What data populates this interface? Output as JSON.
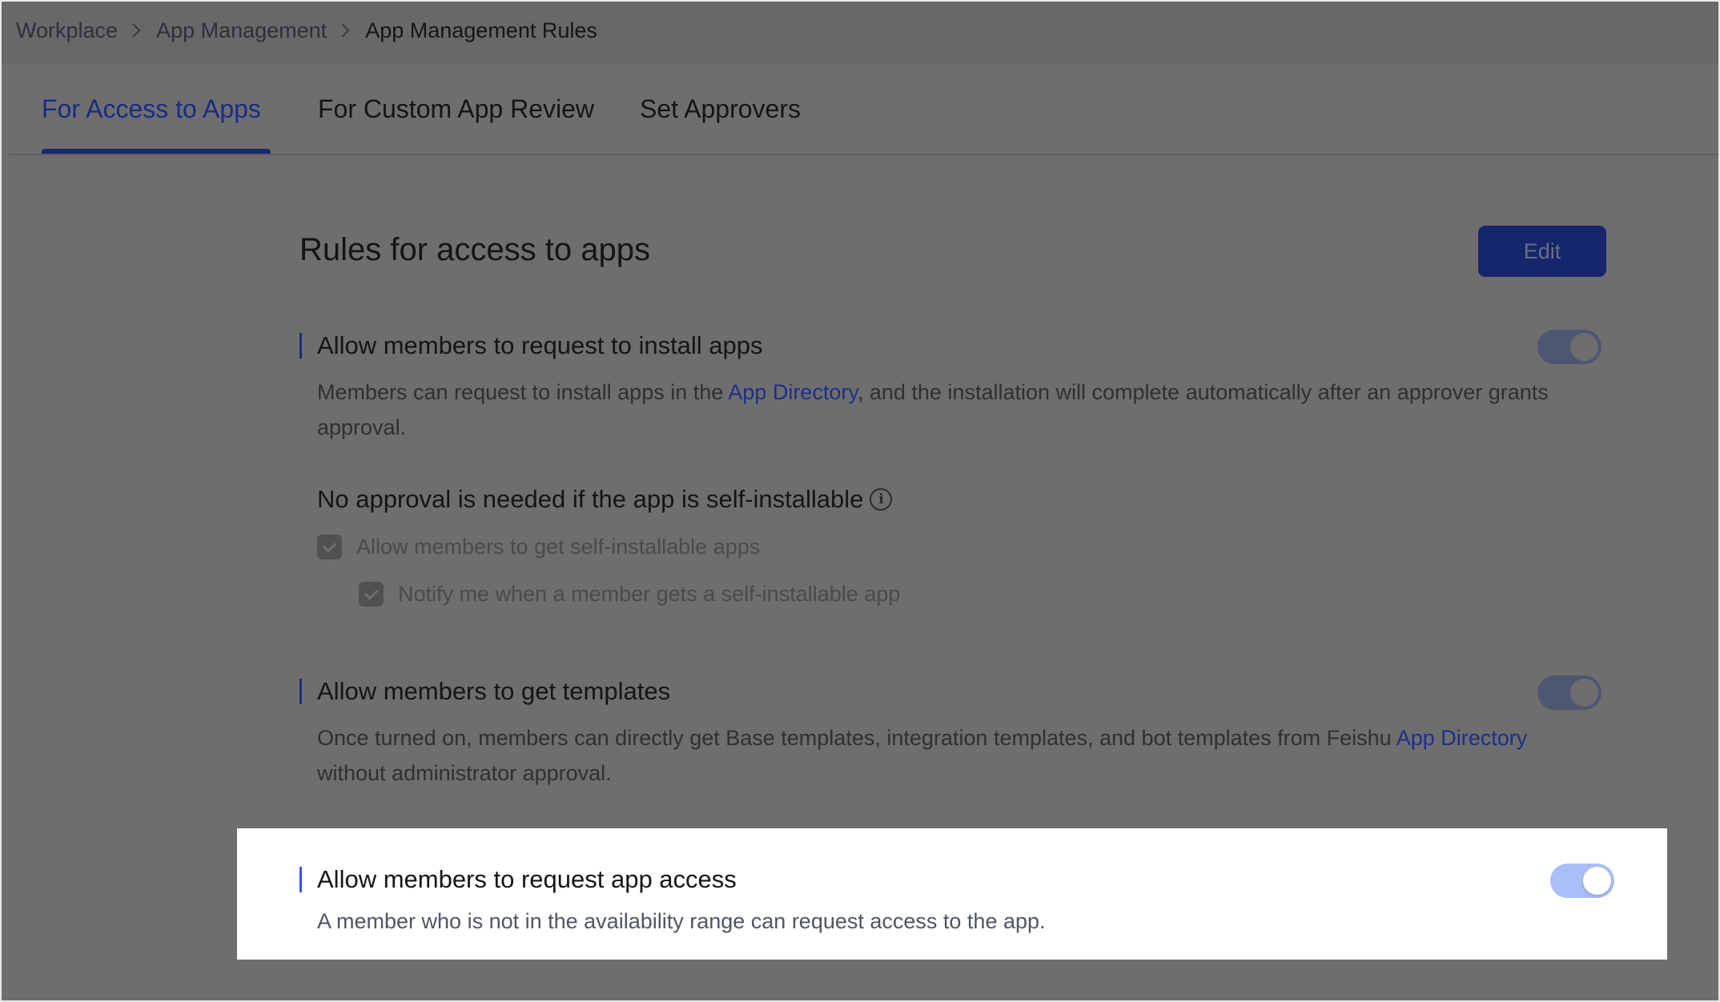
{
  "breadcrumb": {
    "items": [
      "Workplace",
      "App Management",
      "App Management Rules"
    ]
  },
  "tabs": [
    {
      "label": "For Access to Apps",
      "active": true
    },
    {
      "label": "For Custom App Review",
      "active": false
    },
    {
      "label": "Set Approvers",
      "active": false
    }
  ],
  "page": {
    "title": "Rules for access to apps",
    "edit_label": "Edit"
  },
  "sections": [
    {
      "heading": "Allow members to request to install apps",
      "desc_before": "Members can request to install apps in the ",
      "desc_link": "App Directory",
      "desc_after": ", and the installation will complete automatically after an approver grants approval.",
      "toggle_on": true,
      "subheading": "No approval is needed if the app is self-installable",
      "info_icon": "info-icon",
      "checkboxes": [
        {
          "label": "Allow members to get self-installable apps",
          "checked": true
        },
        {
          "label": "Notify me when a member gets a self-installable app",
          "checked": true
        }
      ]
    },
    {
      "heading": "Allow members to get templates",
      "desc_before": "Once turned on, members can directly get Base templates, integration templates, and bot templates from Feishu ",
      "desc_link": "App Directory",
      "desc_after": " without administrator approval.",
      "toggle_on": true
    },
    {
      "heading": "Allow members to request app access",
      "desc": "A member who is not in the availability range can request access to the app.",
      "toggle_on": true
    }
  ],
  "colors": {
    "accent": "#3355f0",
    "toggle_on": "#aabff8",
    "overlay": "#6e6e6e"
  }
}
